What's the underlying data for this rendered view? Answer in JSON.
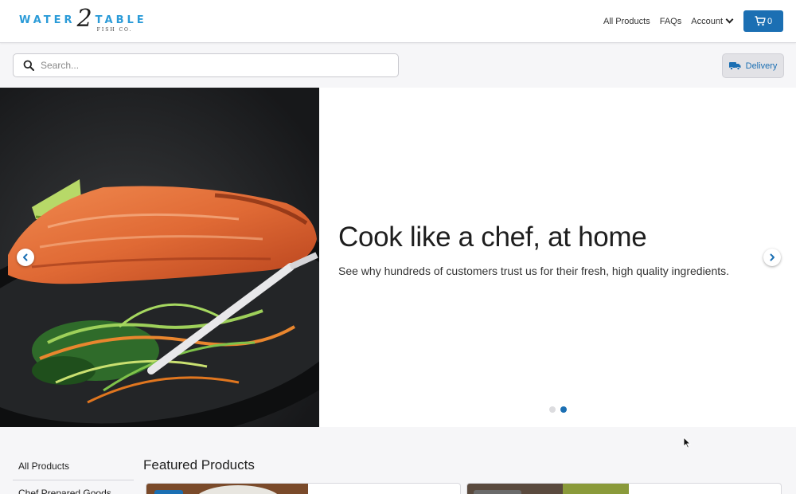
{
  "brand": {
    "word_left": "WATER",
    "numeral": "2",
    "word_right": "TABLE",
    "sub": "FISH CO.",
    "accent_color": "#2b9bd8"
  },
  "nav": {
    "links": [
      "All Products",
      "FAQs"
    ],
    "account_label": "Account",
    "cart_count": "0",
    "cart_icon": "cart-icon",
    "cart_color": "#1b6fb3"
  },
  "search": {
    "placeholder": "Search...",
    "value": "",
    "icon": "search-icon"
  },
  "delivery": {
    "label": "Delivery",
    "icon": "truck-icon"
  },
  "hero": {
    "title": "Cook like a chef, at home",
    "subtitle": "See why hundreds of customers trust us for their fresh, high quality ingredients.",
    "slide_count": 2,
    "active_slide": 2
  },
  "sidebar": {
    "items": [
      "All Products",
      "Chef Prepared Goods"
    ]
  },
  "featured": {
    "title": "Featured Products"
  }
}
